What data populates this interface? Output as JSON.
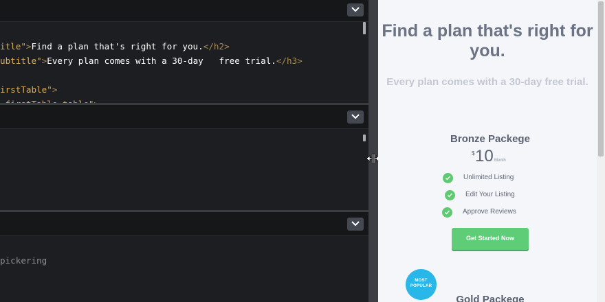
{
  "html_pane": {
    "lines": [
      {
        "parts": [
          {
            "t": "itle\"",
            "c": "tok-attr"
          },
          {
            "t": ">",
            "c": "tok-tag"
          },
          {
            "t": "Find a plan that's right for you.",
            "c": "tok-txt"
          },
          {
            "t": "</h2>",
            "c": "tok-tag"
          }
        ]
      },
      {
        "parts": [
          {
            "t": "ubtitle\"",
            "c": "tok-attr"
          },
          {
            "t": ">",
            "c": "tok-tag"
          },
          {
            "t": "Every plan comes with a 30-day   free trial.",
            "c": "tok-txt"
          },
          {
            "t": "</h3>",
            "c": "tok-tag"
          }
        ]
      },
      {
        "parts": []
      },
      {
        "parts": [
          {
            "t": "irstTable\"",
            "c": "tok-attr"
          },
          {
            "t": ">",
            "c": "tok-tag"
          }
        ]
      },
      {
        "parts": [
          {
            "t": " firstTable_table\"",
            "c": "tok-attr"
          },
          {
            "t": ">",
            "c": "tok-tag"
          }
        ]
      }
    ]
  },
  "js_pane": {
    "lines": [
      {
        "parts": [
          {
            "t": "pickering",
            "c": "tok-muted"
          }
        ]
      }
    ]
  },
  "colors": {
    "editor_bg": "#1d1e22",
    "accent_green": "#5fcc77",
    "badge_blue": "#29b6e8"
  },
  "preview": {
    "title": "Find a plan that's right for you.",
    "subtitle": "Every plan comes with a 30-day free trial.",
    "plans": [
      {
        "name": "Bronze Packege",
        "currency": "$",
        "price": "10",
        "period": "Month",
        "features": [
          "Unlimited Listing",
          "Edit Your Listing",
          "Approve Reviews"
        ],
        "cta": "Get Started Now"
      },
      {
        "name": "Gold Packege",
        "badge_line1": "MOST",
        "badge_line2": "POPULAR"
      }
    ]
  }
}
